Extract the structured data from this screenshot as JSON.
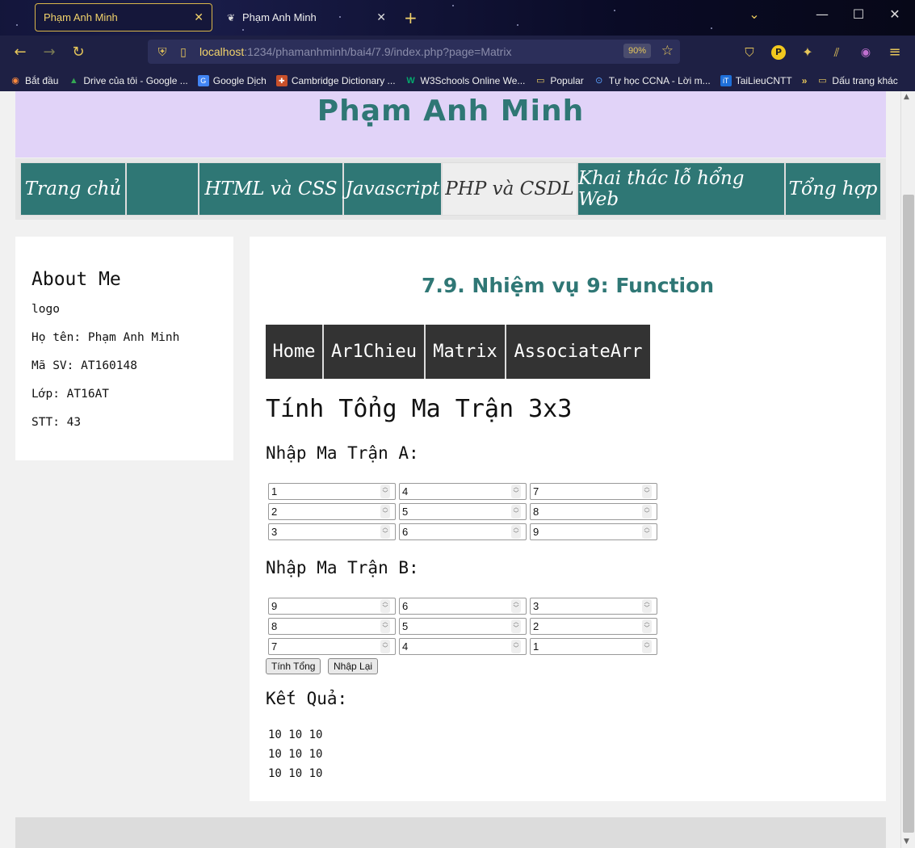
{
  "browser": {
    "tabs": [
      {
        "title": "Phạm Anh Minh",
        "active": true
      },
      {
        "title": "Phạm Anh Minh",
        "active": false
      }
    ],
    "url_host": "localhost",
    "url_path": ":1234/phamanhminh/bai4/7.9/index.php?page=Matrix",
    "zoom": "90%",
    "bookmarks": [
      {
        "label": "Bắt đầu",
        "icon": "firefox-icon"
      },
      {
        "label": "Drive của tôi - Google ...",
        "icon": "google-drive-icon"
      },
      {
        "label": "Google Dịch",
        "icon": "google-translate-icon"
      },
      {
        "label": "Cambridge Dictionary ...",
        "icon": "cambridge-icon"
      },
      {
        "label": "W3Schools Online We...",
        "icon": "w3schools-icon"
      },
      {
        "label": "Popular",
        "icon": "folder-icon"
      },
      {
        "label": "Tự học CCNA - Lời m...",
        "icon": "ccna-icon"
      },
      {
        "label": "TaiLieuCNTT",
        "icon": "tailieucntt-icon"
      }
    ],
    "bookmarks_other": "Dấu trang khác"
  },
  "site": {
    "title": "Phạm Anh Minh",
    "nav": [
      "Trang chủ",
      "",
      "HTML và CSS",
      "Javascript",
      "PHP và CSDL",
      "Khai thác lỗ hổng Web",
      "Tổng hợp"
    ],
    "active_nav": "PHP và CSDL"
  },
  "sidebar": {
    "heading": "About Me",
    "logo": "logo",
    "name_label": "Họ tên:",
    "name_value": "Phạm Anh Minh",
    "id_label": "Mã SV:",
    "id_value": "AT160148",
    "class_label": "Lớp:",
    "class_value": "AT16AT",
    "stt_label": "STT:",
    "stt_value": "43"
  },
  "main": {
    "title": "7.9. Nhiệm vụ 9: Function",
    "subnav": [
      "Home",
      "Ar1Chieu",
      "Matrix",
      "AssociateArr"
    ],
    "heading": "Tính Tổng Ma Trận 3x3",
    "matrix_a_label": "Nhập Ma Trận A:",
    "matrix_a": [
      [
        "1",
        "4",
        "7"
      ],
      [
        "2",
        "5",
        "8"
      ],
      [
        "3",
        "6",
        "9"
      ]
    ],
    "matrix_b_label": "Nhập Ma Trận B:",
    "matrix_b": [
      [
        "9",
        "6",
        "3"
      ],
      [
        "8",
        "5",
        "2"
      ],
      [
        "7",
        "4",
        "1"
      ]
    ],
    "submit_label": "Tính Tổng",
    "reset_label": "Nhập Lại",
    "result_label": "Kết Quả:",
    "result_rows": [
      "10 10 10",
      "10 10 10",
      "10 10 10"
    ]
  }
}
